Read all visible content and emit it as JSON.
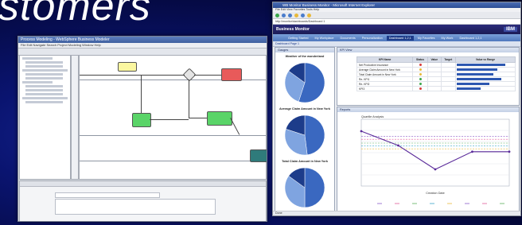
{
  "headline": "stomers",
  "left_window": {
    "title": "Process Modeling - WebSphere Business Modeler",
    "menu": "File  Edit  Navigate  Search  Project  Modeling  Window  Help"
  },
  "right_window": {
    "title": "WB Monitor Business Monitor - Microsoft Internet Explorer",
    "menu": "File  Edit  View  Favorites  Tools  Help",
    "address": "http://monitor/dashboards/Dashboard 1",
    "app_name": "Business Monitor",
    "brand": "IBM",
    "nav_tabs": [
      "Getting Started",
      "My Workplace",
      "Documents",
      "Personalization",
      "Dashboard 1,2,1",
      "My Favorites",
      "My Work",
      "Dashboard 1,2,1"
    ],
    "active_nav_index": 4,
    "subnav": "Dashboard Page 1",
    "gauges_panel_title": "Gauges",
    "kpi_panel_title": "KPI View",
    "reports_panel_title": "Reports",
    "pies": [
      {
        "title": "Weather of the wonderland",
        "slices": [
          0.55,
          0.3,
          0.15
        ]
      },
      {
        "title": "Average Claim Amount in New York",
        "slices": [
          0.48,
          0.32,
          0.2
        ]
      },
      {
        "title": "Total Claim Amount in New York",
        "slices": [
          0.5,
          0.35,
          0.15
        ]
      }
    ],
    "kpi_table": {
      "columns": [
        "KPI Name",
        "Status",
        "Value",
        "Target",
        "Value vs Range"
      ],
      "rows": [
        {
          "name": "Net Productive Insurance",
          "status_color": "#d83a3a",
          "value": "",
          "target": "",
          "fill": 0.92
        },
        {
          "name": "Average Claim Amount in New York",
          "status_color": "#e8b93a",
          "value": "",
          "target": "",
          "fill": 0.78
        },
        {
          "name": "Total Claim Amount in New York",
          "status_color": "#e8b93a",
          "value": "",
          "target": "",
          "fill": 0.7
        },
        {
          "name": "Re- KPI1",
          "status_color": "#3aa64a",
          "value": "",
          "target": "",
          "fill": 0.85
        },
        {
          "name": "Re- KPI2",
          "status_color": "#3aa64a",
          "value": "",
          "target": "",
          "fill": 0.62
        },
        {
          "name": "KPI3",
          "status_color": "#d83a3a",
          "value": "",
          "target": "",
          "fill": 0.45
        }
      ]
    },
    "report_chart_title": "Quartile Analysis",
    "status_bar": "Done"
  },
  "chart_data": {
    "type": "line",
    "title": "Quartile Analysis",
    "xlabel": "Creation Date",
    "ylabel": "",
    "x": [
      1,
      2,
      3,
      4,
      5
    ],
    "series": [
      {
        "name": "",
        "values": [
          3.15,
          2.85,
          2.35,
          2.72,
          2.72
        ]
      }
    ],
    "reference_lines": [
      3.04,
      2.98,
      2.9,
      2.84,
      2.78
    ],
    "ylim": [
      2.0,
      3.4
    ],
    "grid": true,
    "legend": "bottom"
  }
}
